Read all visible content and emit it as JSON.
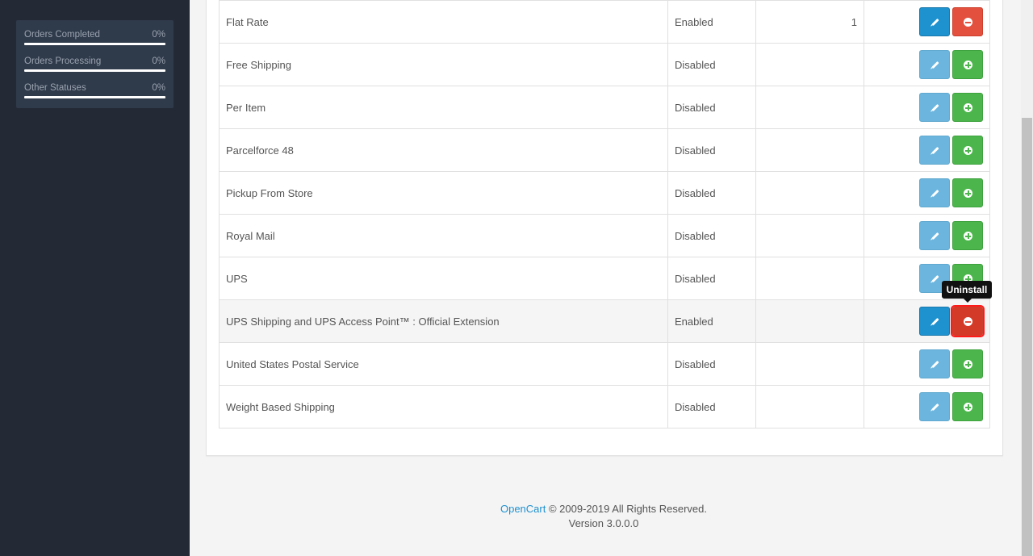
{
  "sidebar": {
    "stats": [
      {
        "label": "Orders Completed",
        "value": "0%"
      },
      {
        "label": "Orders Processing",
        "value": "0%"
      },
      {
        "label": "Other Statuses",
        "value": "0%"
      }
    ]
  },
  "table": {
    "rows": [
      {
        "name": "Flat Rate",
        "status": "Enabled",
        "sort_order": "1"
      },
      {
        "name": "Free Shipping",
        "status": "Disabled",
        "sort_order": ""
      },
      {
        "name": "Per Item",
        "status": "Disabled",
        "sort_order": ""
      },
      {
        "name": "Parcelforce 48",
        "status": "Disabled",
        "sort_order": ""
      },
      {
        "name": "Pickup From Store",
        "status": "Disabled",
        "sort_order": ""
      },
      {
        "name": "Royal Mail",
        "status": "Disabled",
        "sort_order": ""
      },
      {
        "name": "UPS",
        "status": "Disabled",
        "sort_order": ""
      },
      {
        "name": "UPS Shipping and UPS Access Point™ : Official Extension",
        "status": "Enabled",
        "sort_order": ""
      },
      {
        "name": "United States Postal Service",
        "status": "Disabled",
        "sort_order": ""
      },
      {
        "name": "Weight Based Shipping",
        "status": "Disabled",
        "sort_order": ""
      }
    ]
  },
  "tooltip": {
    "text": "Uninstall"
  },
  "footer": {
    "brand": "OpenCart",
    "copyright": "© 2009-2019 All Rights Reserved.",
    "version": "Version 3.0.0.0"
  },
  "colors": {
    "edit": "#1e91cf",
    "install": "#4cb64c",
    "uninstall": "#e3503e",
    "sidebar": "#232a36"
  }
}
